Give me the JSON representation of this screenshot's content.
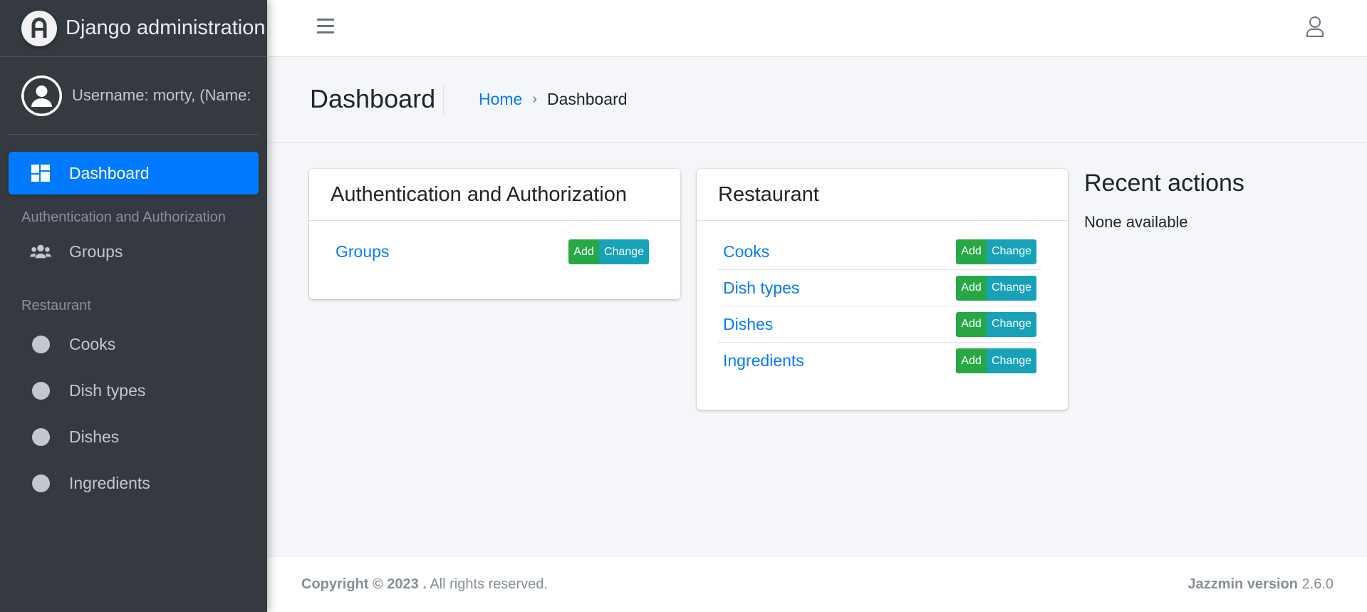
{
  "brand": {
    "title": "Django administration"
  },
  "user": {
    "name_label": "Username: morty, (Name:"
  },
  "sidebar": {
    "items": [
      {
        "label": "Dashboard",
        "icon": "dashboard-icon",
        "active": true
      }
    ],
    "sections": [
      {
        "header": "Authentication and Authorization",
        "items": [
          {
            "label": "Groups",
            "icon": "users-icon"
          }
        ]
      },
      {
        "header": "Restaurant",
        "items": [
          {
            "label": "Cooks",
            "icon": "circle-icon"
          },
          {
            "label": "Dish types",
            "icon": "circle-icon"
          },
          {
            "label": "Dishes",
            "icon": "circle-icon"
          },
          {
            "label": "Ingredients",
            "icon": "circle-icon"
          }
        ]
      }
    ]
  },
  "header": {
    "title": "Dashboard",
    "breadcrumb": {
      "home": "Home",
      "separator": "›",
      "current": "Dashboard"
    }
  },
  "apps": [
    {
      "title": "Authentication and Authorization",
      "models": [
        {
          "name": "Groups",
          "add": "Add",
          "change": "Change"
        }
      ]
    },
    {
      "title": "Restaurant",
      "models": [
        {
          "name": "Cooks",
          "add": "Add",
          "change": "Change"
        },
        {
          "name": "Dish types",
          "add": "Add",
          "change": "Change"
        },
        {
          "name": "Dishes",
          "add": "Add",
          "change": "Change"
        },
        {
          "name": "Ingredients",
          "add": "Add",
          "change": "Change"
        }
      ]
    }
  ],
  "recent_actions": {
    "title": "Recent actions",
    "empty": "None available"
  },
  "footer": {
    "copyright_bold": "Copyright © 2023 .",
    "copyright_rest": " All rights reserved.",
    "version_label": "Jazzmin version",
    "version_value": " 2.6.0"
  },
  "colors": {
    "sidebar_bg": "#343a40",
    "active": "#007bff",
    "add_btn": "#28a745",
    "change_btn": "#17a2b8",
    "link": "#007bff"
  }
}
